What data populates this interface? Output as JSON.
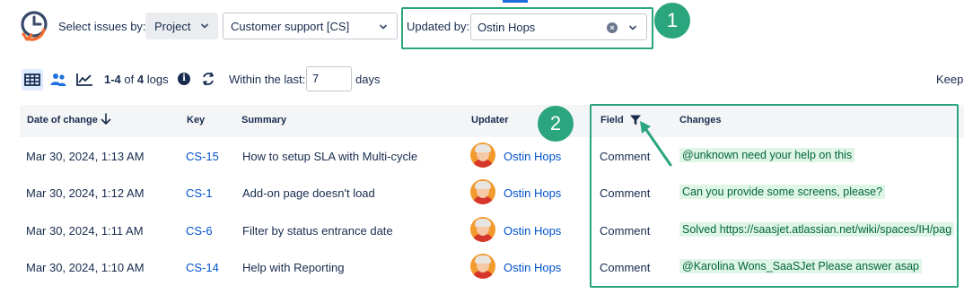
{
  "filters": {
    "select_label": "Select issues by:",
    "scope_value": "Project",
    "project_value": "Customer support [CS]",
    "updated_by_label": "Updated by:",
    "updated_by_value": "Ostin Hops"
  },
  "annotations": {
    "badge1": "1",
    "badge2": "2"
  },
  "toolbar": {
    "count_range": "1-4",
    "count_of": "of",
    "count_total": "4",
    "count_unit": "logs",
    "within_label": "Within the last:",
    "days_value": "7",
    "days_label": "days",
    "keep_label": "Keep"
  },
  "table": {
    "headers": {
      "date": "Date of change",
      "key": "Key",
      "summary": "Summary",
      "updater": "Updater",
      "field": "Field",
      "changes": "Changes"
    },
    "rows": [
      {
        "date": "Mar 30, 2024, 1:13 AM",
        "key": "CS-15",
        "summary": "How to setup SLA with Multi-cycle",
        "updater": "Ostin Hops",
        "field": "Comment",
        "change": "@unknown need your help on this"
      },
      {
        "date": "Mar 30, 2024, 1:12 AM",
        "key": "CS-1",
        "summary": "Add-on page doesn't load",
        "updater": "Ostin Hops",
        "field": "Comment",
        "change": "Can you provide some screens, please?"
      },
      {
        "date": "Mar 30, 2024, 1:11 AM",
        "key": "CS-6",
        "summary": "Filter by status entrance date",
        "updater": "Ostin Hops",
        "field": "Comment",
        "change": "Solved https://saasjet.atlassian.net/wiki/spaces/IH/pag"
      },
      {
        "date": "Mar 30, 2024, 1:10 AM",
        "key": "CS-14",
        "summary": "Help with Reporting",
        "updater": "Ostin Hops",
        "field": "Comment",
        "change": "@Karolina Wons_SaaSJet Please answer asap"
      }
    ]
  },
  "colors": {
    "accent": "#2aa57d",
    "link": "#0052cc",
    "change_bg": "#dff5e6"
  },
  "icons": [
    "history-logo-icon",
    "chevron-down-icon",
    "clear-icon",
    "table-view-icon",
    "people-view-icon",
    "chart-view-icon",
    "info-icon",
    "refresh-icon",
    "sort-down-icon",
    "filter-icon"
  ]
}
